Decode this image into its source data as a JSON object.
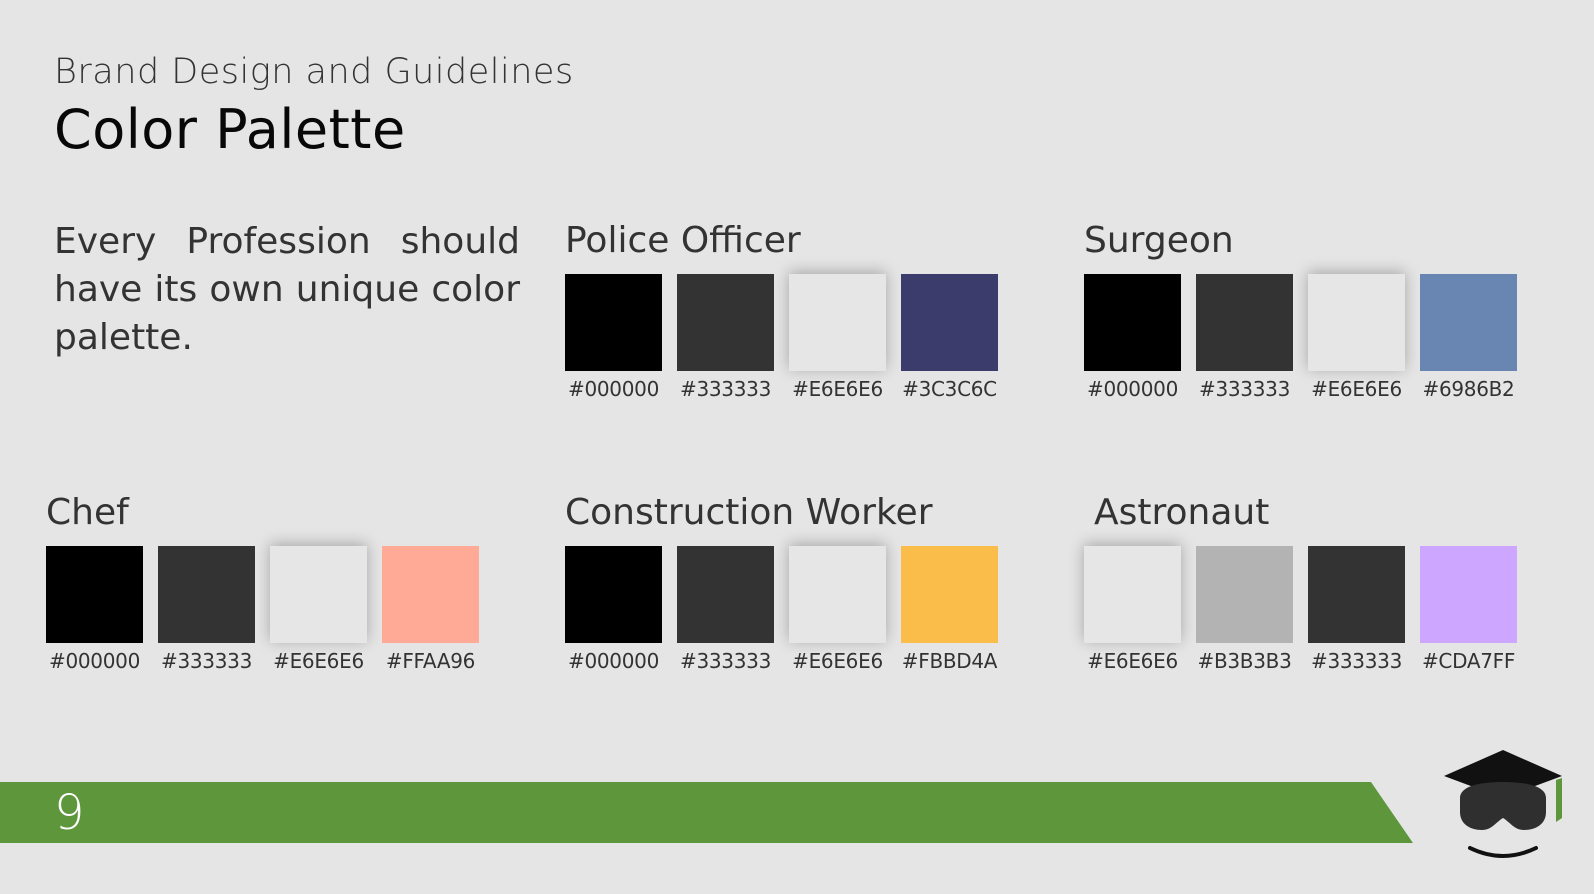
{
  "header": {
    "subtitle": "Brand Design and Guidelines",
    "title": "Color Palette"
  },
  "intro": {
    "text": "Every Profession should have its own unique color palette."
  },
  "palettes": [
    {
      "name": "Police Officer",
      "colors": [
        {
          "hex": "#000000",
          "label": "#000000"
        },
        {
          "hex": "#333333",
          "label": "#333333"
        },
        {
          "hex": "#E6E6E6",
          "label": "#E6E6E6"
        },
        {
          "hex": "#3C3C6C",
          "label": "#3C3C6C"
        }
      ]
    },
    {
      "name": "Surgeon",
      "colors": [
        {
          "hex": "#000000",
          "label": "#000000"
        },
        {
          "hex": "#333333",
          "label": "#333333"
        },
        {
          "hex": "#E6E6E6",
          "label": "#E6E6E6"
        },
        {
          "hex": "#6986B2",
          "label": "#6986B2"
        }
      ]
    },
    {
      "name": "Chef",
      "colors": [
        {
          "hex": "#000000",
          "label": "#000000"
        },
        {
          "hex": "#333333",
          "label": "#333333"
        },
        {
          "hex": "#E6E6E6",
          "label": "#E6E6E6"
        },
        {
          "hex": "#FFAA96",
          "label": "#FFAA96"
        }
      ]
    },
    {
      "name": "Construction Worker",
      "colors": [
        {
          "hex": "#000000",
          "label": "#000000"
        },
        {
          "hex": "#333333",
          "label": "#333333"
        },
        {
          "hex": "#E6E6E6",
          "label": "#E6E6E6"
        },
        {
          "hex": "#FBBD4A",
          "label": "#FBBD4A"
        }
      ]
    },
    {
      "name": "Astronaut",
      "colors": [
        {
          "hex": "#E6E6E6",
          "label": "#E6E6E6"
        },
        {
          "hex": "#B3B3B3",
          "label": "#B3B3B3"
        },
        {
          "hex": "#333333",
          "label": "#333333"
        },
        {
          "hex": "#CDA7FF",
          "label": "#CDA7FF"
        }
      ]
    }
  ],
  "footer": {
    "page_number": "9",
    "bar_color": "#5E963C",
    "logo_icon": "graduation-cap-goggles-logo"
  }
}
